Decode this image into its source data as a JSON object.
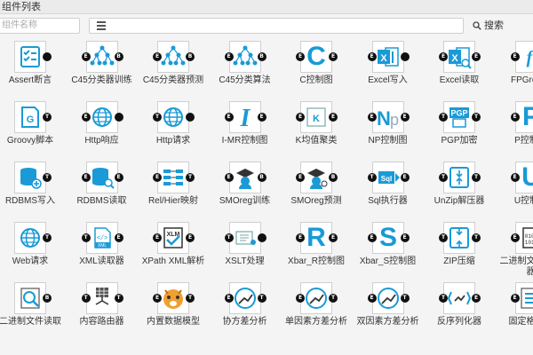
{
  "window": {
    "title": "组件列表"
  },
  "toolbar": {
    "search_placeholder": "组件名称",
    "search_button": "搜索"
  },
  "components": [
    {
      "label": "Assert断言",
      "icon": "checklist-icon",
      "in": "",
      "out": ""
    },
    {
      "label": "C45分类器训练",
      "icon": "tree-icon",
      "in": "E",
      "out": "B"
    },
    {
      "label": "C45分类器预测",
      "icon": "tree-icon",
      "in": "E",
      "out": "B"
    },
    {
      "label": "C45分类算法",
      "icon": "tree-icon",
      "in": "E",
      "out": "B"
    },
    {
      "label": "C控制图",
      "icon": "letter-c-icon",
      "in": "E",
      "out": "E"
    },
    {
      "label": "Excel写入",
      "icon": "excel-write-icon",
      "in": "E",
      "out": ""
    },
    {
      "label": "Excel读取",
      "icon": "excel-read-icon",
      "in": "E",
      "out": "E"
    },
    {
      "label": "FPGrowth",
      "icon": "fpgrowth-icon",
      "in": "E",
      "out": "E"
    },
    {
      "label": "Groovy脚本",
      "icon": "groovy-icon",
      "in": "",
      "out": "T"
    },
    {
      "label": "Http响应",
      "icon": "globe-icon",
      "in": "E",
      "out": ""
    },
    {
      "label": "Http请求",
      "icon": "globe-icon",
      "in": "T",
      "out": ""
    },
    {
      "label": "I-MR控制图",
      "icon": "letter-i-icon",
      "in": "E",
      "out": "E"
    },
    {
      "label": "K均值聚类",
      "icon": "cluster-icon",
      "in": "E",
      "out": "E"
    },
    {
      "label": "NP控制图",
      "icon": "np-icon",
      "in": "E",
      "out": "E"
    },
    {
      "label": "PGP加密",
      "icon": "pgp-icon",
      "in": "T",
      "out": "T"
    },
    {
      "label": "P控制图",
      "icon": "letter-p-icon",
      "in": "E",
      "out": "E"
    },
    {
      "label": "RDBMS写入",
      "icon": "db-write-icon",
      "in": "",
      "out": "T"
    },
    {
      "label": "RDBMS读取",
      "icon": "db-read-icon",
      "in": "E",
      "out": "E"
    },
    {
      "label": "Rel/Hier映射",
      "icon": "mapping-icon",
      "in": "E",
      "out": "T"
    },
    {
      "label": "SMOreg训练",
      "icon": "smoreg-train-icon",
      "in": "E",
      "out": "B"
    },
    {
      "label": "SMOreg预测",
      "icon": "smoreg-predict-icon",
      "in": "E",
      "out": "B"
    },
    {
      "label": "Sql执行器",
      "icon": "sql-icon",
      "in": "T",
      "out": "E"
    },
    {
      "label": "UnZip解压器",
      "icon": "unzip-icon",
      "in": "T",
      "out": "T"
    },
    {
      "label": "U控制图",
      "icon": "letter-u-icon",
      "in": "E",
      "out": "E"
    },
    {
      "label": "Web请求",
      "icon": "globe-icon",
      "in": "",
      "out": "T"
    },
    {
      "label": "XML读取器",
      "icon": "xml-file-icon",
      "in": "T",
      "out": "E"
    },
    {
      "label": "XPath XML解析",
      "icon": "xpath-icon",
      "in": "E",
      "out": "E"
    },
    {
      "label": "XSLT处理",
      "icon": "xslt-icon",
      "in": "T",
      "out": ""
    },
    {
      "label": "Xbar_R控制图",
      "icon": "letter-r-icon",
      "in": "E",
      "out": "E"
    },
    {
      "label": "Xbar_S控制图",
      "icon": "letter-s-icon",
      "in": "E",
      "out": "E"
    },
    {
      "label": "ZIP压缩",
      "icon": "zip-icon",
      "in": "T",
      "out": "T"
    },
    {
      "label": "二进制文件写入器",
      "icon": "binary-file-icon",
      "in": "E",
      "out": "T"
    },
    {
      "label": "二进制文件读取",
      "icon": "binary-read-icon",
      "in": "",
      "out": "B"
    },
    {
      "label": "内容路由器",
      "icon": "grid-router-icon",
      "in": "T",
      "out": "T"
    },
    {
      "label": "内置数据模型",
      "icon": "tiger-icon",
      "in": "E",
      "out": "T"
    },
    {
      "label": "协方差分析",
      "icon": "covariance-icon",
      "in": "E",
      "out": "T"
    },
    {
      "label": "单因素方差分析",
      "icon": "anova-one-icon",
      "in": "E",
      "out": "T"
    },
    {
      "label": "双因素方差分析",
      "icon": "anova-two-icon",
      "in": "E",
      "out": "T"
    },
    {
      "label": "反序列化器",
      "icon": "deserialize-icon",
      "in": "T",
      "out": "E"
    },
    {
      "label": "固定格式化",
      "icon": "fixed-format-icon",
      "in": "E",
      "out": "T"
    }
  ]
}
